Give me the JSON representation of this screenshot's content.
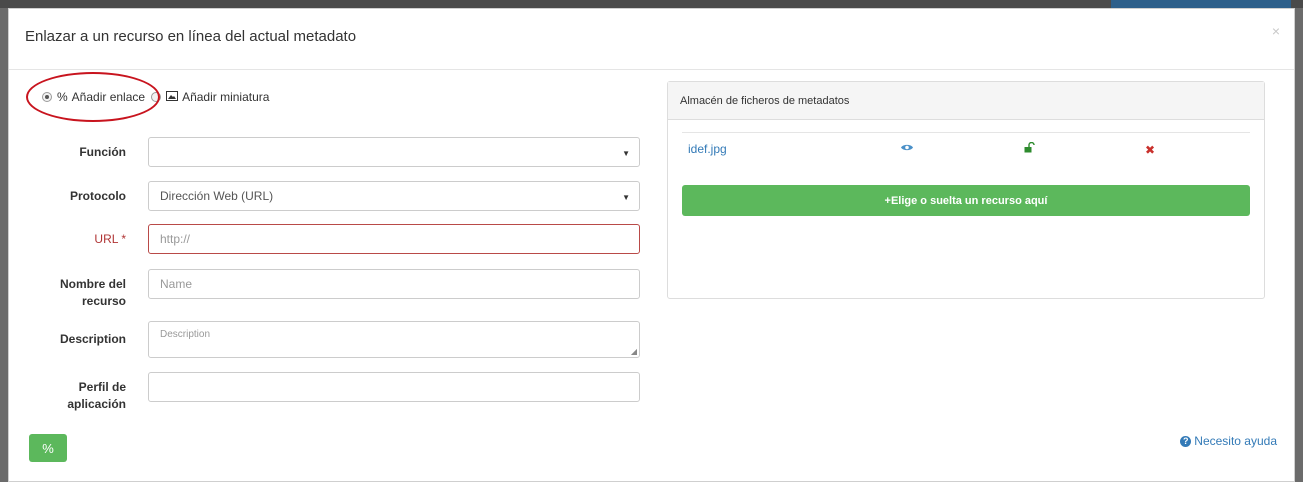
{
  "dialog": {
    "title": "Enlazar a un recurso en línea del actual metadato",
    "close_symbol": "×"
  },
  "mode": {
    "options": [
      {
        "label": "Añadir enlace",
        "icon": "link-icon",
        "checked": true
      },
      {
        "label": "Añadir miniatura",
        "icon": "image-icon",
        "checked": false
      }
    ]
  },
  "form": {
    "funcion": {
      "label": "Función",
      "value": ""
    },
    "protocolo": {
      "label": "Protocolo",
      "value": "Dirección Web (URL)"
    },
    "url": {
      "label": "URL *",
      "placeholder": "http://"
    },
    "nombre": {
      "label_line1": "Nombre del",
      "label_line2": "recurso",
      "placeholder": "Name"
    },
    "description": {
      "label": "Description",
      "placeholder": "Description"
    },
    "perfil": {
      "label_line1": "Perfil de",
      "label_line2": "aplicación",
      "value": ""
    }
  },
  "store": {
    "heading": "Almacén de ficheros de metadatos",
    "files": [
      {
        "name": "idef.jpg"
      }
    ],
    "upload_label": "Elige o suelta un recurso aquí",
    "upload_prefix": "+"
  },
  "help": {
    "label": "Necesito ayuda",
    "icon": "question-circle-icon"
  },
  "colors": {
    "accent_green": "#5cb85c",
    "link_blue": "#337ab7",
    "error_red": "#b94a48",
    "annotation_red": "#c8141e"
  }
}
